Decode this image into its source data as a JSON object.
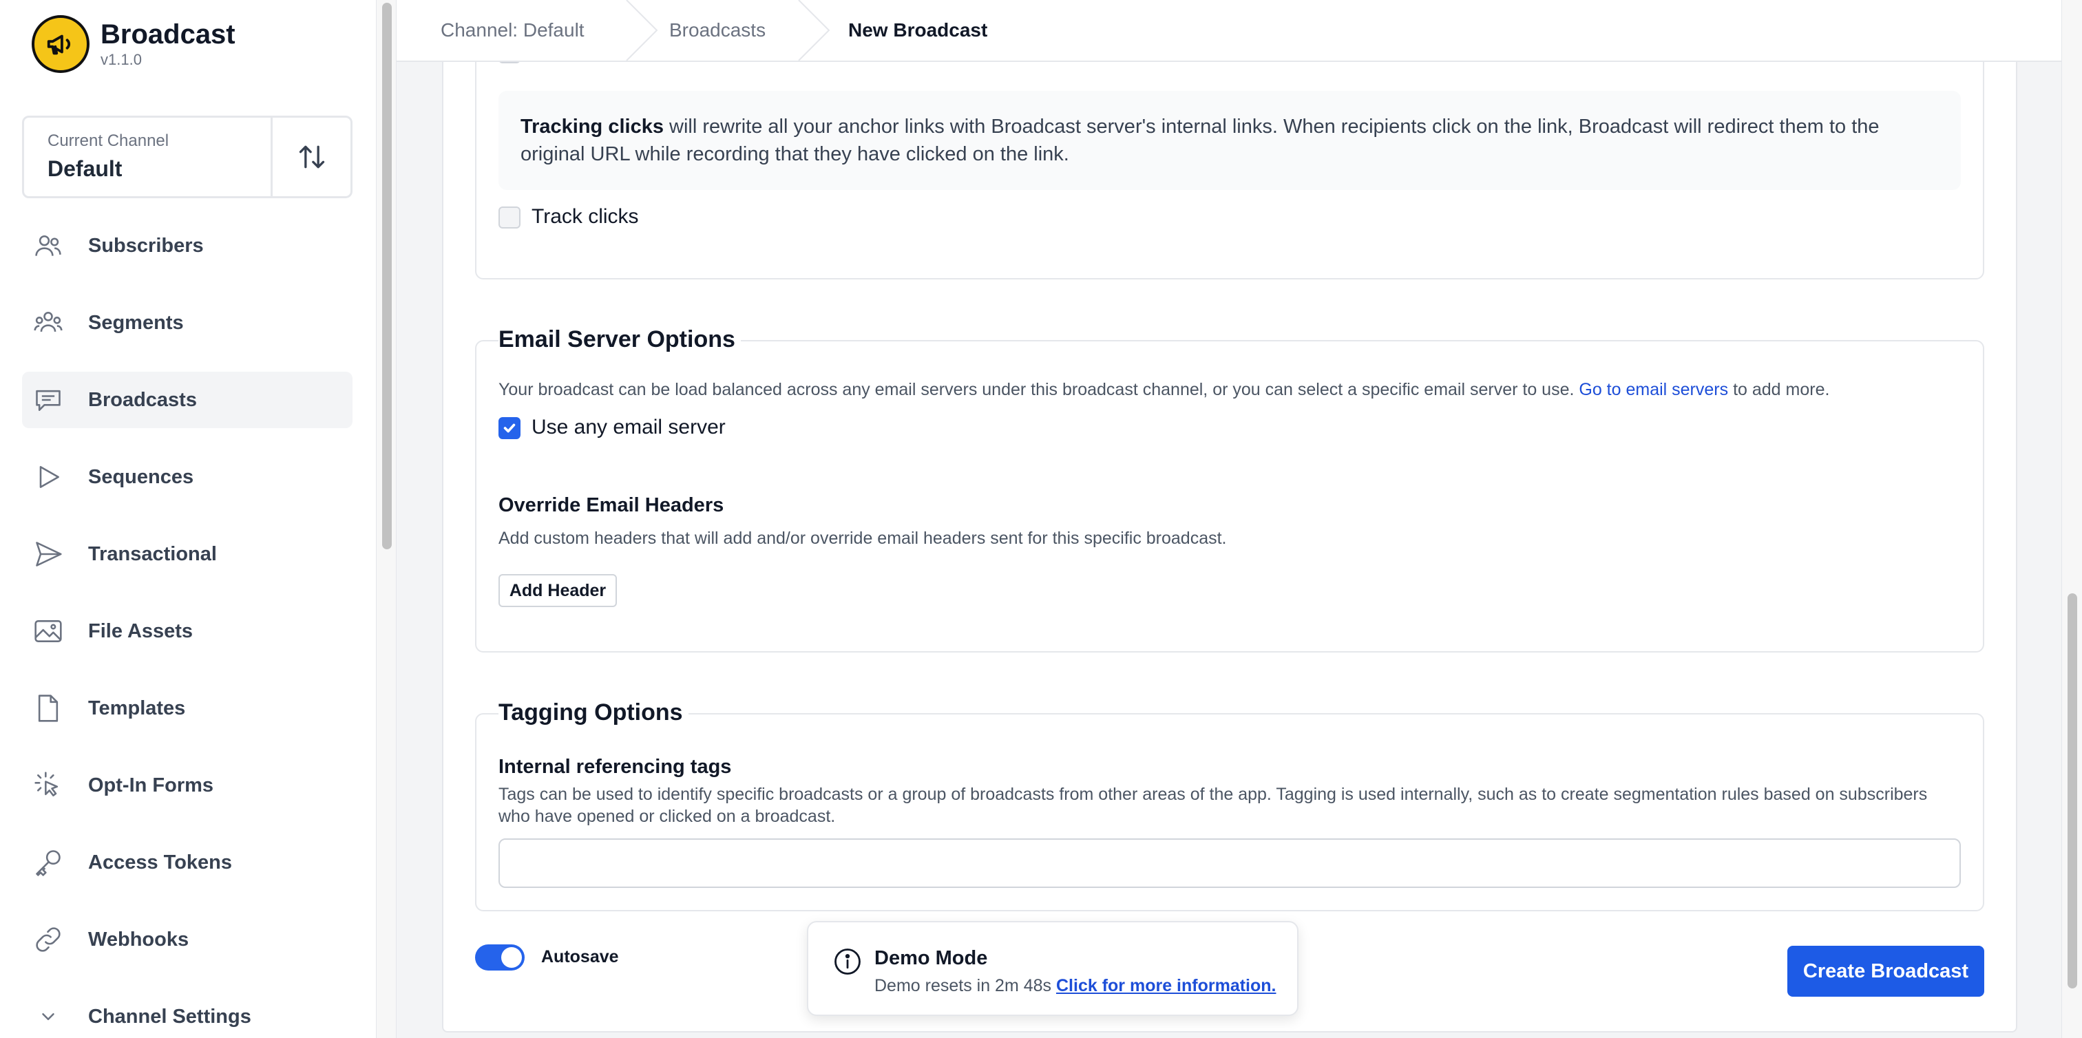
{
  "app": {
    "name": "Broadcast",
    "version": "v1.1.0"
  },
  "channel": {
    "label": "Current Channel",
    "value": "Default"
  },
  "sidebar": {
    "items": [
      {
        "label": "Subscribers",
        "icon": "users-icon"
      },
      {
        "label": "Segments",
        "icon": "user-group-icon"
      },
      {
        "label": "Broadcasts",
        "icon": "chat-icon",
        "active": true
      },
      {
        "label": "Sequences",
        "icon": "play-icon"
      },
      {
        "label": "Transactional",
        "icon": "paper-plane-icon"
      },
      {
        "label": "File Assets",
        "icon": "image-icon"
      },
      {
        "label": "Templates",
        "icon": "document-icon"
      },
      {
        "label": "Opt-In Forms",
        "icon": "cursor-click-icon"
      },
      {
        "label": "Access Tokens",
        "icon": "key-icon"
      },
      {
        "label": "Webhooks",
        "icon": "link-icon"
      },
      {
        "label": "Channel Settings",
        "icon": "chevron-down-icon"
      }
    ]
  },
  "breadcrumbs": [
    "Channel: Default",
    "Broadcasts",
    "New Broadcast"
  ],
  "tracking": {
    "tip_bold": "Tracking clicks",
    "tip_rest": " will rewrite all your anchor links with Broadcast server's internal links. When recipients click on the link, Broadcast will redirect them to the original URL while recording that they have clicked on the link.",
    "track_clicks_label": "Track clicks",
    "track_clicks_checked": false
  },
  "email_server": {
    "legend": "Email Server Options",
    "help_before": "Your broadcast can be load balanced across any email servers under this broadcast channel, or you can select a specific email server to use. ",
    "help_link": "Go to email servers",
    "help_after": " to add more.",
    "use_any_label": "Use any email server",
    "use_any_checked": true,
    "override_title": "Override Email Headers",
    "override_help": "Add custom headers that will add and/or override email headers sent for this specific broadcast.",
    "add_header_label": "Add Header"
  },
  "tagging": {
    "legend": "Tagging Options",
    "title": "Internal referencing tags",
    "help": "Tags can be used to identify specific broadcasts or a group of broadcasts from other areas of the app. Tagging is used internally, such as to create segmentation rules based on subscribers who have opened or clicked on a broadcast.",
    "value": ""
  },
  "footer": {
    "autosave_label": "Autosave",
    "autosave_on": true,
    "create_label": "Create Broadcast"
  },
  "toast": {
    "title": "Demo Mode",
    "body": "Demo resets in 2m 48s ",
    "link": "Click for more information."
  },
  "colors": {
    "accent": "#2563eb",
    "logo": "#f5c518"
  }
}
